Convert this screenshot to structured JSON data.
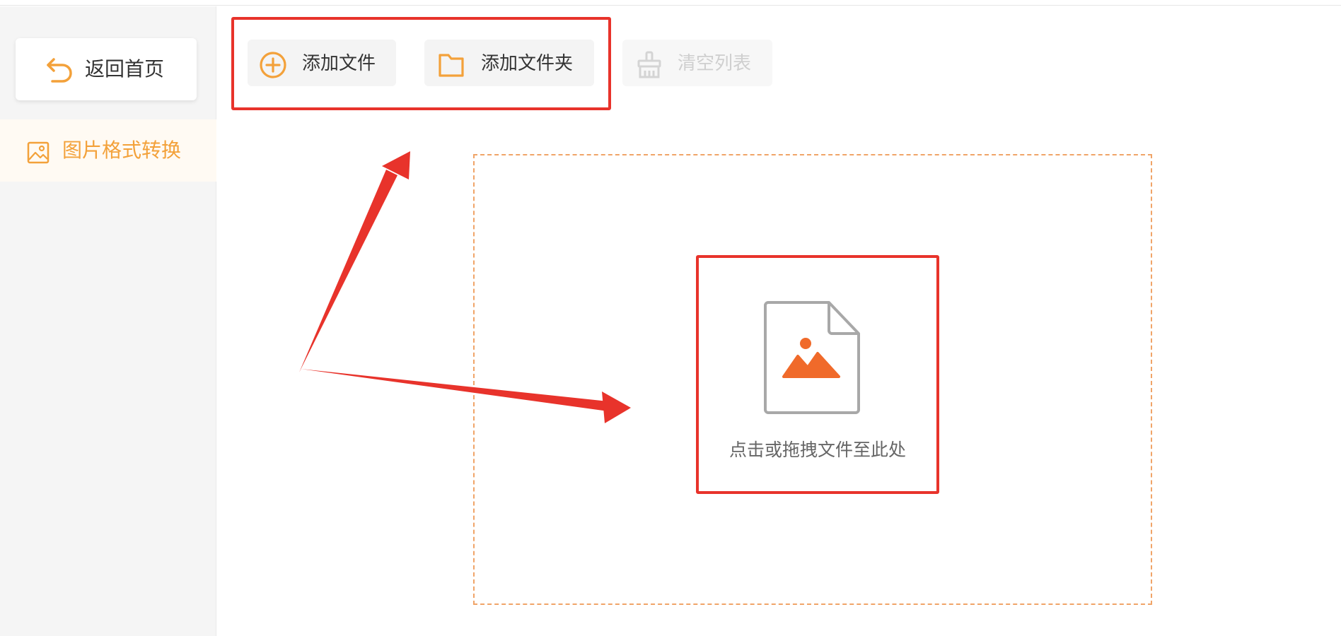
{
  "colors": {
    "accent": "#f3a13a",
    "annotation": "#e8332b",
    "image_icon": "#f06a2a"
  },
  "sidebar": {
    "back_button": {
      "label": "返回首页",
      "icon": "undo-arrow-icon"
    },
    "items": [
      {
        "label": "图片格式转换",
        "icon": "image-icon",
        "active": true
      }
    ]
  },
  "toolbar": {
    "add_file": {
      "label": "添加文件",
      "icon": "plus-circle-icon"
    },
    "add_folder": {
      "label": "添加文件夹",
      "icon": "folder-icon"
    },
    "clear_list": {
      "label": "清空列表",
      "icon": "broom-icon",
      "disabled": true
    }
  },
  "dropzone": {
    "hint": "点击或拖拽文件至此处",
    "icon": "image-file-icon"
  }
}
